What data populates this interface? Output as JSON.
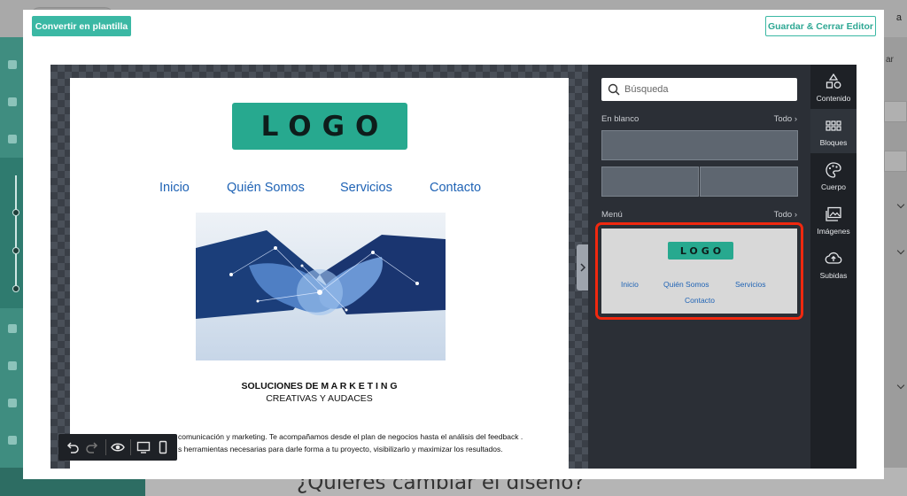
{
  "background": {
    "user_initial": "a",
    "bottom_heading": "¿Quieres cambiar el diseño?",
    "right_label": "ar"
  },
  "modal": {
    "convert_button": "Convertir en plantilla",
    "save_button": "Guardar & Cerrar Editor"
  },
  "email": {
    "logo_text": "LOGO",
    "nav": [
      "Inicio",
      "Quién Somos",
      "Servicios",
      "Contacto"
    ],
    "heading_line1": "SOLUCIONES DE M A R K E T I N G",
    "heading_line2": "CREATIVAS Y AUDACES",
    "paragraph_line1": "comunicación y marketing. Te acompañamos desde el plan de negocios hasta el análisis del feedback .",
    "paragraph_line2": "s herramientas necesarias para darle forma a tu proyecto, visibilizarlo y maximizar los resultados."
  },
  "panel": {
    "search_placeholder": "Búsqueda",
    "blank_label": "En blanco",
    "blank_all": "Todo ›",
    "menu_label": "Menú",
    "menu_all": "Todo ›",
    "menu_preview": {
      "logo_text": "LOGO",
      "nav": [
        "Inicio",
        "Quién Somos",
        "Servicios",
        "Contacto"
      ]
    }
  },
  "tabs": [
    {
      "label": "Contenido",
      "icon": "shapes-icon"
    },
    {
      "label": "Bloques",
      "icon": "grid-dots-icon"
    },
    {
      "label": "Cuerpo",
      "icon": "palette-icon"
    },
    {
      "label": "Imágenes",
      "icon": "images-icon"
    },
    {
      "label": "Subidas",
      "icon": "cloud-upload-icon"
    }
  ],
  "colors": {
    "accent": "#3bb8a4",
    "logo_bg": "#27a98f",
    "link": "#1f63b5",
    "highlight": "#f0280f",
    "editor_dark": "#2b2f36"
  }
}
